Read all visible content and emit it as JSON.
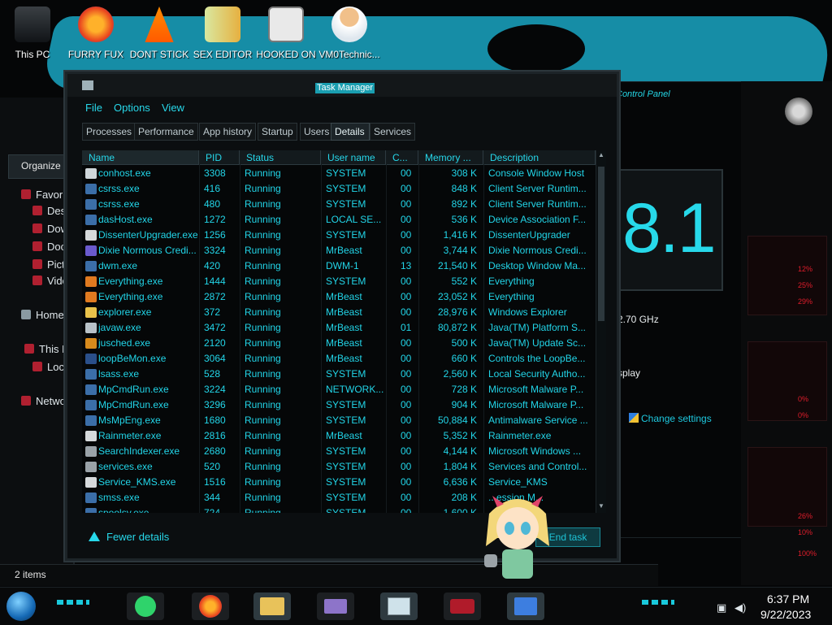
{
  "desktop": {
    "icons": [
      {
        "label": "This PC"
      },
      {
        "label": "FURRY FUX"
      },
      {
        "label": "DONT STICK"
      },
      {
        "label": "SEX EDITOR"
      },
      {
        "label": "HOOKED ON"
      },
      {
        "label": "VM0Technic..."
      }
    ]
  },
  "explorer": {
    "organize_label": "Organize",
    "nav": [
      {
        "label": "Favor"
      },
      {
        "label": "Des"
      },
      {
        "label": "Dow"
      },
      {
        "label": "Doc"
      },
      {
        "label": "Pict"
      },
      {
        "label": "Vide"
      },
      {
        "label": "Home"
      },
      {
        "label": "This F"
      },
      {
        "label": "Loc"
      },
      {
        "label": "Netwo"
      }
    ],
    "status": "2 items"
  },
  "control_panel": {
    "title": "Control Panel",
    "version_text": "8.1",
    "cpu_speed": "2.70 GHz",
    "text_r": "r",
    "text_display": "splay",
    "change_settings": "Change settings"
  },
  "gauges": {
    "labels": [
      "12%",
      "25%",
      "29%",
      "0%",
      "0%",
      "26%",
      "10%",
      "100%"
    ]
  },
  "task_manager": {
    "title": "Task Manager",
    "menu": [
      "File",
      "Options",
      "View"
    ],
    "tabs": [
      "Processes",
      "Performance",
      "App history",
      "Startup",
      "Users",
      "Details",
      "Services"
    ],
    "active_tab": "Details",
    "columns": [
      "Name",
      "PID",
      "Status",
      "User name",
      "C...",
      "Memory ...",
      "Description"
    ],
    "rows": [
      {
        "name": "conhost.exe",
        "pid": "3308",
        "status": "Running",
        "user": "SYSTEM",
        "cpu": "00",
        "mem": "308 K",
        "desc": "Console Window Host"
      },
      {
        "name": "csrss.exe",
        "pid": "416",
        "status": "Running",
        "user": "SYSTEM",
        "cpu": "00",
        "mem": "848 K",
        "desc": "Client Server Runtim..."
      },
      {
        "name": "csrss.exe",
        "pid": "480",
        "status": "Running",
        "user": "SYSTEM",
        "cpu": "00",
        "mem": "892 K",
        "desc": "Client Server Runtim..."
      },
      {
        "name": "dasHost.exe",
        "pid": "1272",
        "status": "Running",
        "user": "LOCAL SE...",
        "cpu": "00",
        "mem": "536 K",
        "desc": "Device Association F..."
      },
      {
        "name": "DissenterUpgrader.exe",
        "pid": "1256",
        "status": "Running",
        "user": "SYSTEM",
        "cpu": "00",
        "mem": "1,416 K",
        "desc": "DissenterUpgrader"
      },
      {
        "name": "Dixie Normous Credi...",
        "pid": "3324",
        "status": "Running",
        "user": "MrBeast",
        "cpu": "00",
        "mem": "3,744 K",
        "desc": "Dixie Normous Credi..."
      },
      {
        "name": "dwm.exe",
        "pid": "420",
        "status": "Running",
        "user": "DWM-1",
        "cpu": "13",
        "mem": "21,540 K",
        "desc": "Desktop Window Ma..."
      },
      {
        "name": "Everything.exe",
        "pid": "1444",
        "status": "Running",
        "user": "SYSTEM",
        "cpu": "00",
        "mem": "552 K",
        "desc": "Everything"
      },
      {
        "name": "Everything.exe",
        "pid": "2872",
        "status": "Running",
        "user": "MrBeast",
        "cpu": "00",
        "mem": "23,052 K",
        "desc": "Everything"
      },
      {
        "name": "explorer.exe",
        "pid": "372",
        "status": "Running",
        "user": "MrBeast",
        "cpu": "00",
        "mem": "28,976 K",
        "desc": "Windows Explorer"
      },
      {
        "name": "javaw.exe",
        "pid": "3472",
        "status": "Running",
        "user": "MrBeast",
        "cpu": "01",
        "mem": "80,872 K",
        "desc": "Java(TM) Platform S..."
      },
      {
        "name": "jusched.exe",
        "pid": "2120",
        "status": "Running",
        "user": "MrBeast",
        "cpu": "00",
        "mem": "500 K",
        "desc": "Java(TM) Update Sc..."
      },
      {
        "name": "loopBeMon.exe",
        "pid": "3064",
        "status": "Running",
        "user": "MrBeast",
        "cpu": "00",
        "mem": "660 K",
        "desc": "Controls the LoopBe..."
      },
      {
        "name": "lsass.exe",
        "pid": "528",
        "status": "Running",
        "user": "SYSTEM",
        "cpu": "00",
        "mem": "2,560 K",
        "desc": "Local Security Autho..."
      },
      {
        "name": "MpCmdRun.exe",
        "pid": "3224",
        "status": "Running",
        "user": "NETWORK...",
        "cpu": "00",
        "mem": "728 K",
        "desc": "Microsoft Malware P..."
      },
      {
        "name": "MpCmdRun.exe",
        "pid": "3296",
        "status": "Running",
        "user": "SYSTEM",
        "cpu": "00",
        "mem": "904 K",
        "desc": "Microsoft Malware P..."
      },
      {
        "name": "MsMpEng.exe",
        "pid": "1680",
        "status": "Running",
        "user": "SYSTEM",
        "cpu": "00",
        "mem": "50,884 K",
        "desc": "Antimalware Service ..."
      },
      {
        "name": "Rainmeter.exe",
        "pid": "2816",
        "status": "Running",
        "user": "MrBeast",
        "cpu": "00",
        "mem": "5,352 K",
        "desc": "Rainmeter.exe"
      },
      {
        "name": "SearchIndexer.exe",
        "pid": "2680",
        "status": "Running",
        "user": "SYSTEM",
        "cpu": "00",
        "mem": "4,144 K",
        "desc": "Microsoft Windows ..."
      },
      {
        "name": "services.exe",
        "pid": "520",
        "status": "Running",
        "user": "SYSTEM",
        "cpu": "00",
        "mem": "1,804 K",
        "desc": "Services and Control..."
      },
      {
        "name": "Service_KMS.exe",
        "pid": "1516",
        "status": "Running",
        "user": "SYSTEM",
        "cpu": "00",
        "mem": "6,636 K",
        "desc": "Service_KMS"
      },
      {
        "name": "smss.exe",
        "pid": "344",
        "status": "Running",
        "user": "SYSTEM",
        "cpu": "00",
        "mem": "208 K",
        "desc": "...ession M..."
      },
      {
        "name": "spoolsv.exe",
        "pid": "724",
        "status": "Running",
        "user": "SYSTEM",
        "cpu": "00",
        "mem": "1,600 K",
        "desc": "...ystem"
      }
    ],
    "icon_colors": [
      "#cfd6da",
      "#3b6ea8",
      "#3b6ea8",
      "#3b6ea8",
      "#d6d9db",
      "#6a5acd",
      "#3b6ea8",
      "#e07a20",
      "#e07a20",
      "#e9c24a",
      "#b8c2c8",
      "#d88a1c",
      "#2a4f8a",
      "#3b6ea8",
      "#3b6ea8",
      "#3b6ea8",
      "#3b6ea8",
      "#d6d9db",
      "#9aa2a8",
      "#9aa2a8",
      "#d6d9db",
      "#3b6ea8",
      "#3b6ea8"
    ],
    "fewer_details": "Fewer details",
    "end_task": "End task"
  },
  "taskbar": {
    "time": "6:37 PM",
    "date": "9/22/2023"
  }
}
